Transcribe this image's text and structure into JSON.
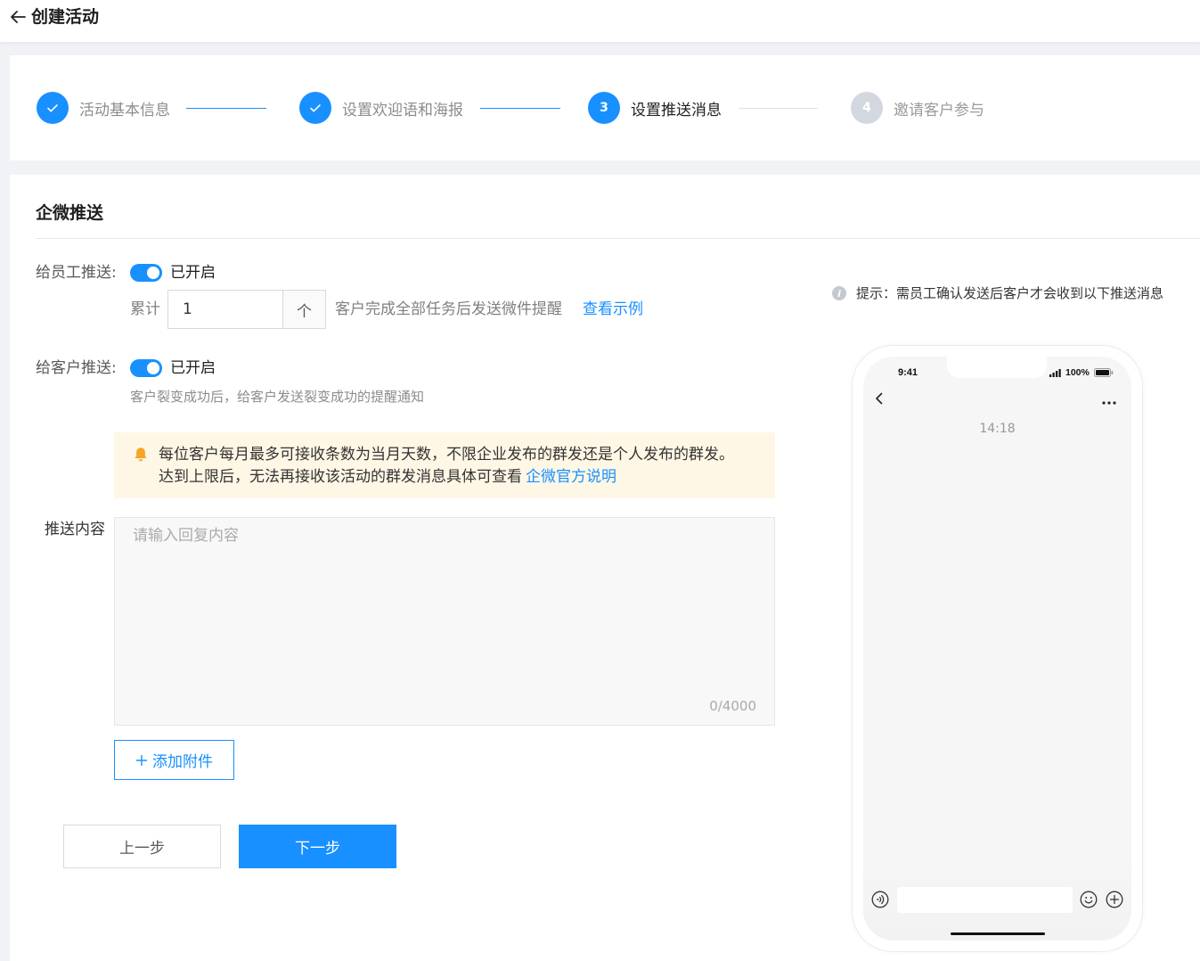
{
  "theme": {
    "primary": "#1890ff",
    "warning_bg": "#fff7e6",
    "warning_icon": "#f5a623",
    "pending_step": "#d3d8e0"
  },
  "header": {
    "back_icon": "arrow-left-icon",
    "title": "创建活动"
  },
  "steps": [
    {
      "label": "活动基本信息",
      "completed": true,
      "current": false,
      "icon": "check-icon"
    },
    {
      "label": "设置欢迎语和海报",
      "completed": true,
      "current": false,
      "icon": "check-icon"
    },
    {
      "number": "3",
      "label": "设置推送消息",
      "completed": false,
      "current": true
    },
    {
      "number": "4",
      "label": "邀请客户参与",
      "completed": false,
      "current": false
    }
  ],
  "section": {
    "title": "企微推送"
  },
  "employee_push": {
    "label": "给员工推送:",
    "enabled": true,
    "status_text": "已开启",
    "cumulative_label": "累计",
    "count_value": "1",
    "count_unit": "个",
    "description": "客户完成全部任务后发送微件提醒",
    "example_link": "查看示例"
  },
  "customer_push": {
    "label": "给客户推送:",
    "enabled": true,
    "status_text": "已开启",
    "description": "客户裂变成功后，给客户发送裂变成功的提醒通知"
  },
  "notice": {
    "icon": "bell-icon",
    "line1": "每位客户每月最多可接收条数为当月天数，不限企业发布的群发还是个人发布的群发。",
    "line2": "达到上限后，无法再接收该活动的群发消息具体可查看",
    "link": "企微官方说明"
  },
  "content": {
    "label": "推送内容",
    "placeholder": "请输入回复内容",
    "counter": "0/4000"
  },
  "attachment": {
    "icon": "plus-icon",
    "label": "添加附件"
  },
  "footer": {
    "prev_label": "上一步",
    "next_label": "下一步"
  },
  "preview": {
    "tip_icon": "info-icon",
    "tip": "提示：需员工确认发送后客户才会收到以下推送消息",
    "status_time": "9:41",
    "battery": "100%",
    "chat_time": "14:18",
    "icons": [
      "signal-icon",
      "battery-icon",
      "chevron-left-icon",
      "more-icon",
      "voice-icon",
      "emoji-icon",
      "plus-circle-icon"
    ]
  }
}
